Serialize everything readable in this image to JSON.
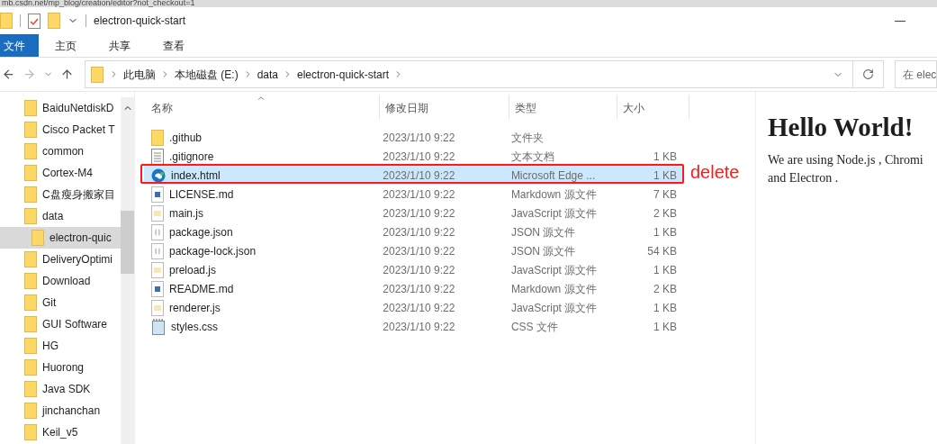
{
  "browser_url": "mb.csdn.net/mp_blog/creation/editor?not_checkout=1",
  "window": {
    "title": "electron-quick-start",
    "minimize": "—"
  },
  "ribbon_tabs": [
    {
      "label": "文件",
      "selected": true
    },
    {
      "label": "主页",
      "selected": false
    },
    {
      "label": "共享",
      "selected": false
    },
    {
      "label": "查看",
      "selected": false
    }
  ],
  "breadcrumb": [
    "此电脑",
    "本地磁盘 (E:)",
    "data",
    "electron-quick-start"
  ],
  "search": {
    "placeholder": "在 elec"
  },
  "sidebar": {
    "items": [
      {
        "label": "BaiduNetdiskD",
        "selected": false
      },
      {
        "label": "Cisco Packet T",
        "selected": false
      },
      {
        "label": "common",
        "selected": false
      },
      {
        "label": "Cortex-M4",
        "selected": false
      },
      {
        "label": "C盘瘦身搬家目",
        "selected": false
      },
      {
        "label": "data",
        "selected": false,
        "children": [
          {
            "label": "electron-quic",
            "selected": true
          }
        ]
      },
      {
        "label": "DeliveryOptimi",
        "selected": false
      },
      {
        "label": "Download",
        "selected": false
      },
      {
        "label": "Git",
        "selected": false
      },
      {
        "label": "GUI Software",
        "selected": false
      },
      {
        "label": "HG",
        "selected": false
      },
      {
        "label": "Huorong",
        "selected": false
      },
      {
        "label": "Java SDK",
        "selected": false
      },
      {
        "label": "jinchanchan",
        "selected": false
      },
      {
        "label": "Keil_v5",
        "selected": false
      }
    ]
  },
  "table": {
    "columns": [
      "名称",
      "修改日期",
      "类型",
      "大小"
    ],
    "rows": [
      {
        "kind": "folder",
        "name": ".github",
        "date": "2023/1/10 9:22",
        "type": "文件夹",
        "selected": false
      },
      {
        "kind": "text",
        "name": ".gitignore",
        "date": "2023/1/10 9:22",
        "type": "文本文档",
        "size": "1 KB",
        "selected": false
      },
      {
        "kind": "html",
        "name": "index.html",
        "date": "2023/1/10 9:22",
        "type": "Microsoft Edge ...",
        "size": "1 KB",
        "selected": true
      },
      {
        "kind": "markdown",
        "name": "LICENSE.md",
        "date": "2023/1/10 9:22",
        "type": "Markdown 源文件",
        "size": "7 KB",
        "selected": false
      },
      {
        "kind": "js",
        "name": "main.js",
        "date": "2023/1/10 9:22",
        "type": "JavaScript 源文件",
        "size": "2 KB",
        "selected": false
      },
      {
        "kind": "json",
        "name": "package.json",
        "date": "2023/1/10 9:22",
        "type": "JSON 源文件",
        "size": "1 KB",
        "selected": false
      },
      {
        "kind": "json",
        "name": "package-lock.json",
        "date": "2023/1/10 9:22",
        "type": "JSON 源文件",
        "size": "54 KB",
        "selected": false
      },
      {
        "kind": "js",
        "name": "preload.js",
        "date": "2023/1/10 9:22",
        "type": "JavaScript 源文件",
        "size": "1 KB",
        "selected": false
      },
      {
        "kind": "markdown",
        "name": "README.md",
        "date": "2023/1/10 9:22",
        "type": "Markdown 源文件",
        "size": "2 KB",
        "selected": false
      },
      {
        "kind": "js",
        "name": "renderer.js",
        "date": "2023/1/10 9:22",
        "type": "JavaScript 源文件",
        "size": "1 KB",
        "selected": false
      },
      {
        "kind": "css",
        "name": "styles.css",
        "date": "2023/1/10 9:22",
        "type": "CSS 文件",
        "size": "1 KB",
        "selected": false
      }
    ]
  },
  "annotation": {
    "label": "delete"
  },
  "preview": {
    "heading": "Hello World!",
    "lines": [
      "We are using Node.js , Chromi",
      "and Electron ."
    ]
  }
}
